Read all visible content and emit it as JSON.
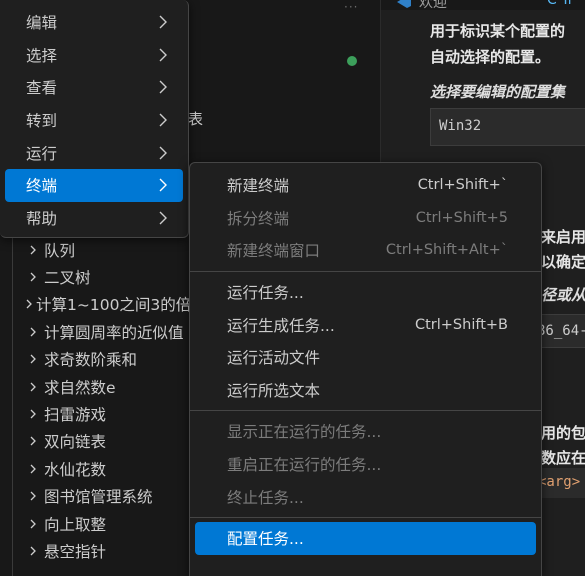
{
  "background": {
    "biao_fragment": "表",
    "tab_fragment": "欢迎",
    "tab2_fragment": "C Tr",
    "tree_items": [
      "队列",
      "二叉树",
      "计算1~100之间3的倍",
      "计算圆周率的近似值",
      "求奇数阶乘和",
      "求自然数e",
      "扫雷游戏",
      "双向链表",
      "水仙花数",
      "图书馆管理系统",
      "向上取整",
      "悬空指针"
    ],
    "editor_lines": {
      "l1": "用于标识某个配置的",
      "l2": "自动选择的配置。",
      "l3": "选择要编辑的配置集",
      "input1": "Win32",
      "l4": "来启用",
      "l5": "以确定",
      "l6": "径或从",
      "input2": "86_64-",
      "l7": "用的包",
      "l8": "数应在",
      "code": "<arg>"
    }
  },
  "main_menu": {
    "items": [
      {
        "label": "编辑"
      },
      {
        "label": "选择"
      },
      {
        "label": "查看"
      },
      {
        "label": "转到"
      },
      {
        "label": "运行"
      },
      {
        "label": "终端"
      },
      {
        "label": "帮助"
      }
    ]
  },
  "terminal_menu": {
    "new_terminal": {
      "label": "新建终端",
      "shortcut": "Ctrl+Shift+`"
    },
    "split_terminal": {
      "label": "拆分终端",
      "shortcut": "Ctrl+Shift+5"
    },
    "new_terminal_window": {
      "label": "新建终端窗口",
      "shortcut": "Ctrl+Shift+Alt+`"
    },
    "run_task": {
      "label": "运行任务..."
    },
    "run_build_task": {
      "label": "运行生成任务...",
      "shortcut": "Ctrl+Shift+B"
    },
    "run_active_file": {
      "label": "运行活动文件"
    },
    "run_selected_text": {
      "label": "运行所选文本"
    },
    "show_running_tasks": {
      "label": "显示正在运行的任务..."
    },
    "restart_running_task": {
      "label": "重启正在运行的任务..."
    },
    "terminate_task": {
      "label": "终止任务..."
    },
    "configure_tasks": {
      "label": "配置任务..."
    }
  },
  "colors": {
    "accent": "#0078d4",
    "menu_bg": "#1f1f1f",
    "disabled_text": "#7c7c7c"
  }
}
